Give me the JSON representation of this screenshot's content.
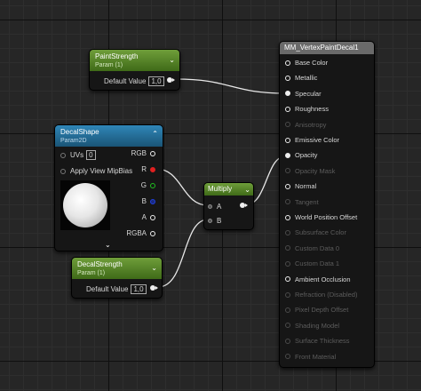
{
  "nodes": {
    "paint_strength": {
      "title": "PaintStrength",
      "subtitle": "Param (1)",
      "field_label": "Default Value",
      "field_value": "1,0"
    },
    "decal_shape": {
      "title": "DecalShape",
      "subtitle": "Param2D",
      "uvs_label": "UVs",
      "uvs_value": "0",
      "mipbias_label": "Apply View MipBias",
      "outputs": [
        "RGB",
        "R",
        "G",
        "B",
        "A",
        "RGBA"
      ]
    },
    "decal_strength": {
      "title": "DecalStrength",
      "subtitle": "Param (1)",
      "field_label": "Default Value",
      "field_value": "1,0"
    },
    "multiply": {
      "title": "Multiply",
      "input_a": "A",
      "input_b": "B"
    },
    "material": {
      "title": "MM_VertexPaintDecal1",
      "inputs": [
        {
          "label": "Base Color",
          "state": "enabled"
        },
        {
          "label": "Metallic",
          "state": "enabled"
        },
        {
          "label": "Specular",
          "state": "connected"
        },
        {
          "label": "Roughness",
          "state": "enabled"
        },
        {
          "label": "Anisotropy",
          "state": "disabled"
        },
        {
          "label": "Emissive Color",
          "state": "enabled"
        },
        {
          "label": "Opacity",
          "state": "connected"
        },
        {
          "label": "Opacity Mask",
          "state": "disabled"
        },
        {
          "label": "Normal",
          "state": "enabled"
        },
        {
          "label": "Tangent",
          "state": "disabled"
        },
        {
          "label": "World Position Offset",
          "state": "enabled"
        },
        {
          "label": "Subsurface Color",
          "state": "disabled"
        },
        {
          "label": "Custom Data 0",
          "state": "disabled"
        },
        {
          "label": "Custom Data 1",
          "state": "disabled"
        },
        {
          "label": "Ambient Occlusion",
          "state": "enabled"
        },
        {
          "label": "Refraction (Disabled)",
          "state": "disabled"
        },
        {
          "label": "Pixel Depth Offset",
          "state": "disabled"
        },
        {
          "label": "Shading Model",
          "state": "disabled"
        },
        {
          "label": "Surface Thickness",
          "state": "disabled"
        },
        {
          "label": "Front Material",
          "state": "disabled"
        }
      ]
    }
  },
  "colors": {
    "pin_r": "#e02020",
    "pin_g": "#20c020",
    "pin_b": "#2040e0",
    "wire": "#e8e8e8"
  },
  "icons": {
    "collapse": "chevron-down-icon",
    "expand": "chevron-up-icon"
  }
}
